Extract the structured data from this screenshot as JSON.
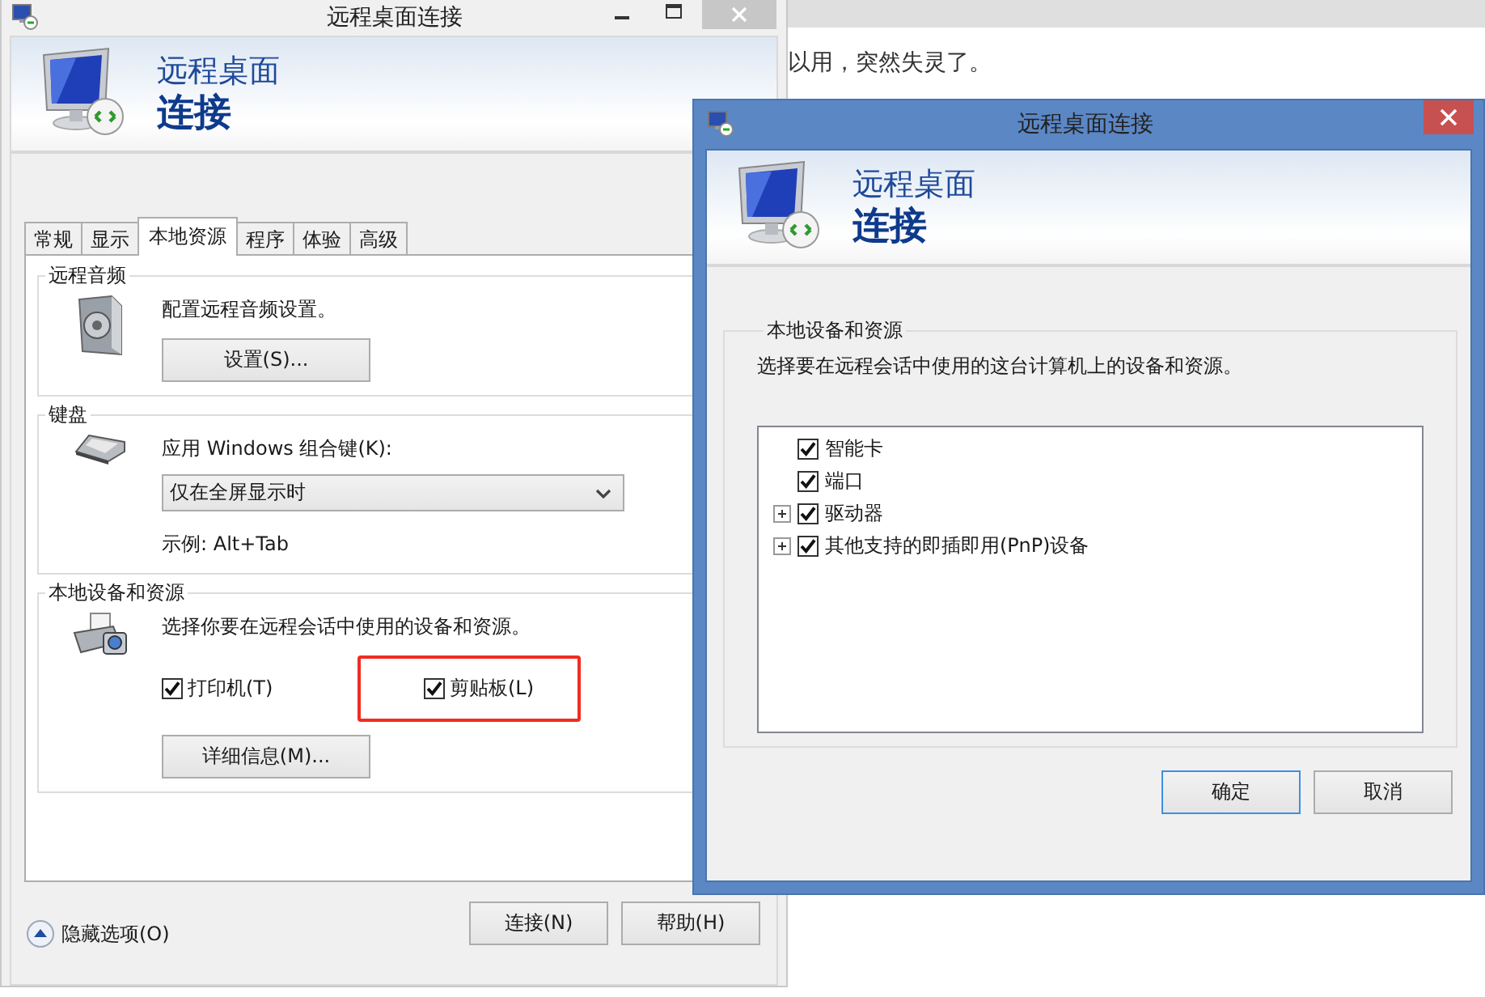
{
  "background_page": {
    "text": "以用，突然失灵了。"
  },
  "main_window": {
    "title": "远程桌面连接",
    "banner": {
      "line1": "远程桌面",
      "line2": "连接"
    },
    "tabs": [
      {
        "label": "常规",
        "selected": false
      },
      {
        "label": "显示",
        "selected": false
      },
      {
        "label": "本地资源",
        "selected": true
      },
      {
        "label": "程序",
        "selected": false
      },
      {
        "label": "体验",
        "selected": false
      },
      {
        "label": "高级",
        "selected": false
      }
    ],
    "groups": [
      {
        "kind": "audio",
        "title": "远程音频",
        "description": "配置远程音频设置。",
        "button": "设置(S)..."
      },
      {
        "kind": "keyboard",
        "title": "键盘",
        "label": "应用 Windows 组合键(K):",
        "dropdown": "仅在全屏显示时",
        "example": "示例: Alt+Tab"
      },
      {
        "kind": "devices",
        "title": "本地设备和资源",
        "description": "选择你要在远程会话中使用的设备和资源。",
        "checkboxes": [
          {
            "label": "打印机(T)",
            "checked": true,
            "highlighted": false
          },
          {
            "label": "剪贴板(L)",
            "checked": true,
            "highlighted": true
          }
        ],
        "button": "详细信息(M)..."
      }
    ],
    "options_toggle": "隐藏选项(O)",
    "buttons": [
      "连接(N)",
      "帮助(H)"
    ]
  },
  "dialog": {
    "title": "远程桌面连接",
    "banner": {
      "line1": "远程桌面",
      "line2": "连接"
    },
    "group": {
      "title": "本地设备和资源",
      "description": "选择要在远程会话中使用的这台计算机上的设备和资源。",
      "tree": [
        {
          "kind": "leaf",
          "label": "智能卡",
          "checked": true
        },
        {
          "kind": "leaf",
          "label": "端口",
          "checked": true
        },
        {
          "kind": "group",
          "label": "驱动器",
          "checked": true,
          "expanded": false
        },
        {
          "kind": "group",
          "label": "其他支持的即插即用(PnP)设备",
          "checked": true,
          "expanded": false
        }
      ]
    },
    "buttons": [
      {
        "label": "确定",
        "default": true
      },
      {
        "label": "取消",
        "default": false
      }
    ]
  }
}
